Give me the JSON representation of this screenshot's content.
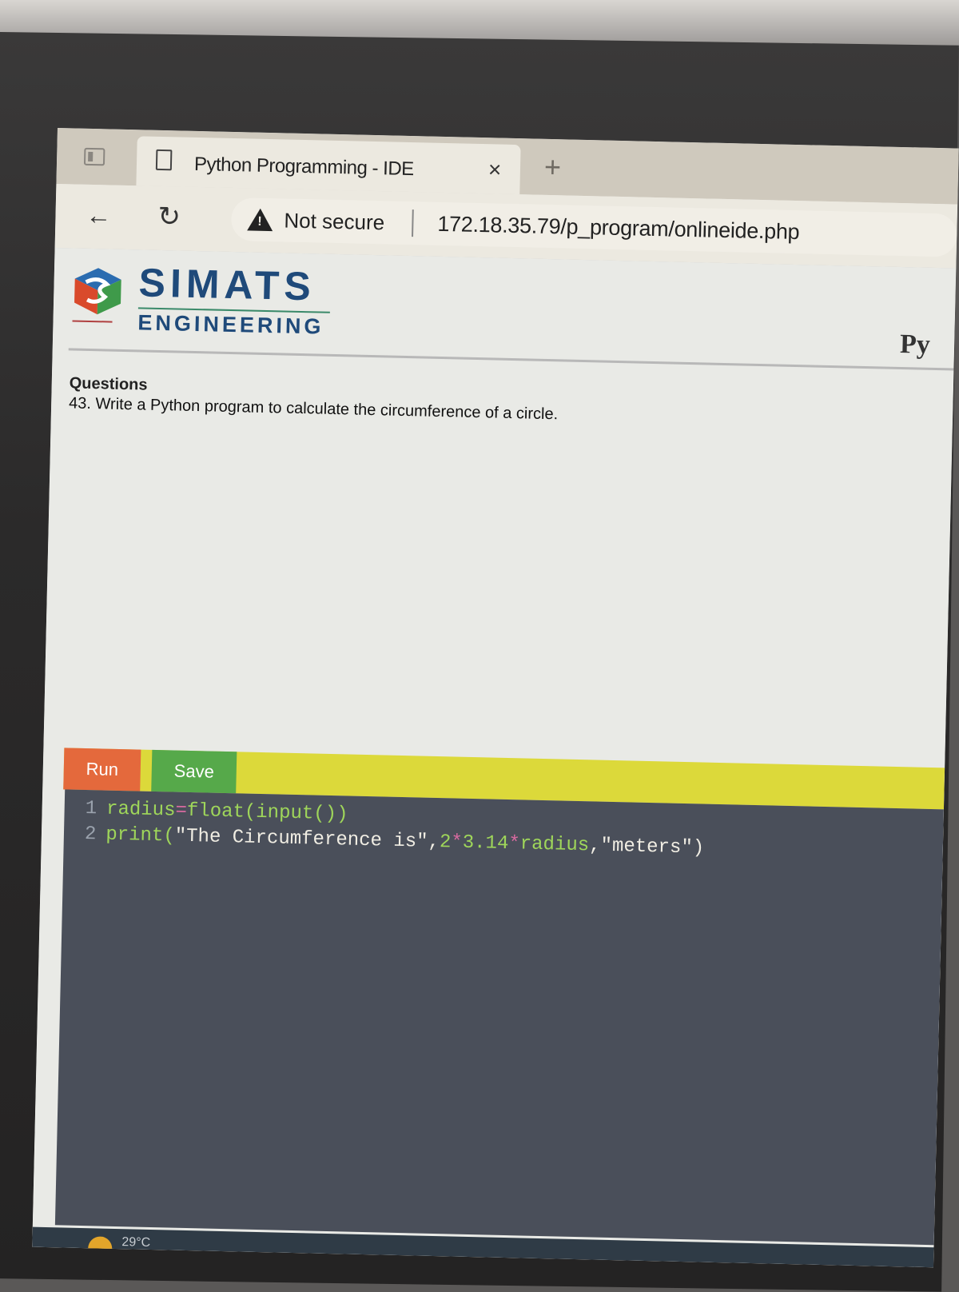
{
  "browser": {
    "tab_title": "Python Programming - IDE",
    "tab_close": "×",
    "new_tab": "+",
    "security_label": "Not secure",
    "url": "172.18.35.79/p_program/onlineide.php"
  },
  "header": {
    "logo_title": "SIMATS",
    "logo_subtitle": "ENGINEERING",
    "right_title_fragment": "Py"
  },
  "question": {
    "heading": "Questions",
    "text": "43. Write a Python program to calculate the circumference of a circle."
  },
  "toolbar": {
    "run_label": "Run",
    "save_label": "Save"
  },
  "editor": {
    "lines": [
      {
        "number": "1",
        "tokens": [
          "radius",
          "=",
          "float(input())"
        ]
      },
      {
        "number": "2",
        "tokens": [
          "print(",
          "\"The Circumference is\"",
          ",",
          "2",
          "*",
          "3.14",
          "*",
          "radius",
          ",",
          "\"meters\"",
          ")"
        ]
      }
    ]
  },
  "taskbar": {
    "weather": "29°C"
  },
  "colors": {
    "run_button": "#e4693c",
    "save_button": "#56a94a",
    "toolbar": "#dcd93a",
    "editor_bg": "#4a4f5a",
    "brand": "#1f4a7a"
  }
}
